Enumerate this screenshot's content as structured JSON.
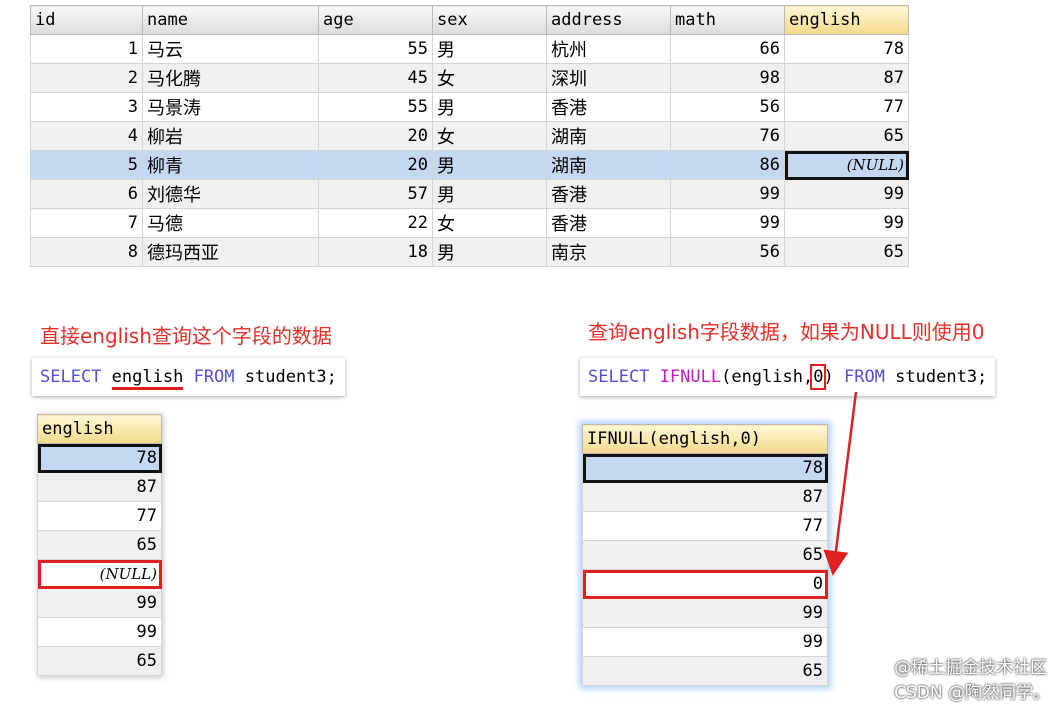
{
  "main_table": {
    "columns": [
      "id",
      "name",
      "age",
      "sex",
      "address",
      "math",
      "english"
    ],
    "rows": [
      {
        "id": "1",
        "name": "马云",
        "age": "55",
        "sex": "男",
        "address": "杭州",
        "math": "66",
        "english": "78"
      },
      {
        "id": "2",
        "name": "马化腾",
        "age": "45",
        "sex": "女",
        "address": "深圳",
        "math": "98",
        "english": "87"
      },
      {
        "id": "3",
        "name": "马景涛",
        "age": "55",
        "sex": "男",
        "address": "香港",
        "math": "56",
        "english": "77"
      },
      {
        "id": "4",
        "name": "柳岩",
        "age": "20",
        "sex": "女",
        "address": "湖南",
        "math": "76",
        "english": "65"
      },
      {
        "id": "5",
        "name": "柳青",
        "age": "20",
        "sex": "男",
        "address": "湖南",
        "math": "86",
        "english": "(NULL)"
      },
      {
        "id": "6",
        "name": "刘德华",
        "age": "57",
        "sex": "男",
        "address": "香港",
        "math": "99",
        "english": "99"
      },
      {
        "id": "7",
        "name": "马德",
        "age": "22",
        "sex": "女",
        "address": "香港",
        "math": "99",
        "english": "99"
      },
      {
        "id": "8",
        "name": "德玛西亚",
        "age": "18",
        "sex": "男",
        "address": "南京",
        "math": "56",
        "english": "65"
      }
    ]
  },
  "left": {
    "caption": "直接english查询这个字段的数据",
    "sql": {
      "kw1": "SELECT",
      "col": "english",
      "kw2": "FROM",
      "rest": "student3;"
    },
    "result_header": "english",
    "result_values": [
      "78",
      "87",
      "77",
      "65",
      "(NULL)",
      "99",
      "99",
      "65"
    ]
  },
  "right": {
    "caption": "查询english字段数据，如果为NULL则使用0",
    "sql": {
      "kw1": "SELECT",
      "fn": "IFNULL",
      "open": "(english,",
      "zero": "0",
      "close": ")",
      "kw2": "FROM",
      "rest": "student3;"
    },
    "result_header": "IFNULL(english,0)",
    "result_values": [
      "78",
      "87",
      "77",
      "65",
      "0",
      "99",
      "99",
      "65"
    ]
  },
  "watermark": "@稀土掘金技术社区\nCSDN @陶然同学。",
  "colors": {
    "accent_red": "#e5302a",
    "keyword": "#5151d8",
    "function": "#c020c0",
    "selected_row": "#c5d8f2"
  }
}
